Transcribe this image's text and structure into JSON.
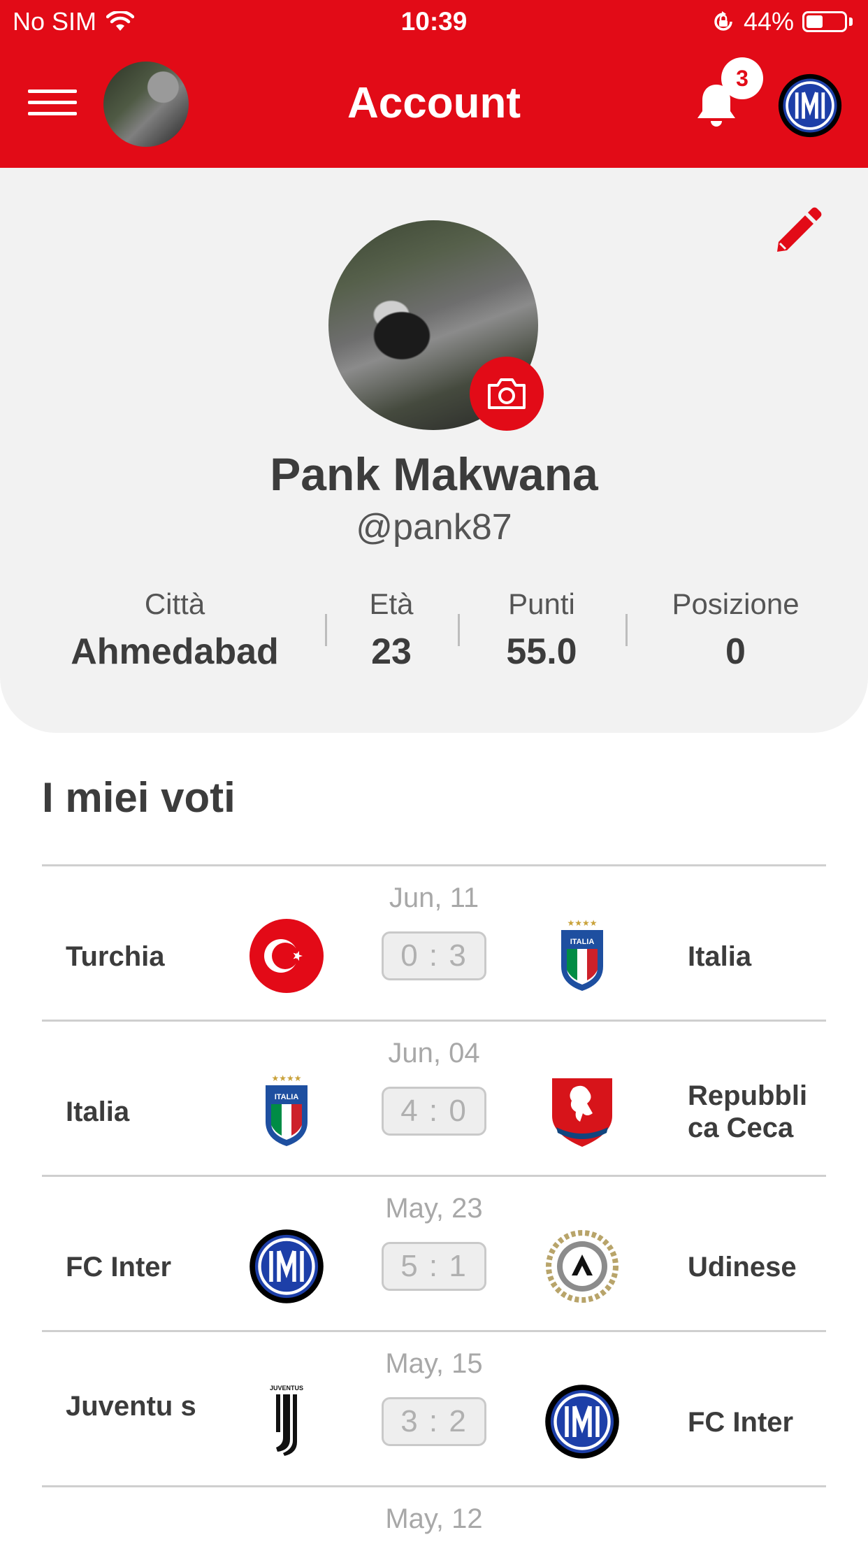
{
  "status_bar": {
    "carrier": "No SIM",
    "time": "10:39",
    "battery": "44%",
    "battery_level": 0.44
  },
  "header": {
    "title": "Account",
    "notification_count": "3"
  },
  "profile": {
    "name": "Pank Makwana",
    "handle": "@pank87",
    "stats": {
      "city_label": "Città",
      "city_value": "Ahmedabad",
      "age_label": "Età",
      "age_value": "23",
      "points_label": "Punti",
      "points_value": "55.0",
      "position_label": "Posizione",
      "position_value": "0"
    }
  },
  "votes": {
    "title": "I miei voti",
    "matches": [
      {
        "date": "Jun, 11",
        "home": "Turchia",
        "home_logo": "turkey-flag-icon",
        "score": "0 : 3",
        "away": "Italia",
        "away_logo": "italy-crest-icon"
      },
      {
        "date": "Jun, 04",
        "home": "Italia",
        "home_logo": "italy-crest-icon",
        "score": "4 : 0",
        "away": "Repubbli ca Ceca",
        "away_logo": "czech-crest-icon"
      },
      {
        "date": "May, 23",
        "home": "FC Inter",
        "home_logo": "inter-logo-icon",
        "score": "5 : 1",
        "away": "Udinese",
        "away_logo": "udinese-crest-icon"
      },
      {
        "date": "May, 15",
        "home": "Juventu s",
        "home_logo": "juventus-logo-icon",
        "score": "3 : 2",
        "away": "FC Inter",
        "away_logo": "inter-logo-icon"
      },
      {
        "date": "May, 12"
      }
    ]
  },
  "colors": {
    "brand_red": "#e20b17",
    "card_bg": "#f2f2f2",
    "score_text": "#b0b0b0"
  }
}
